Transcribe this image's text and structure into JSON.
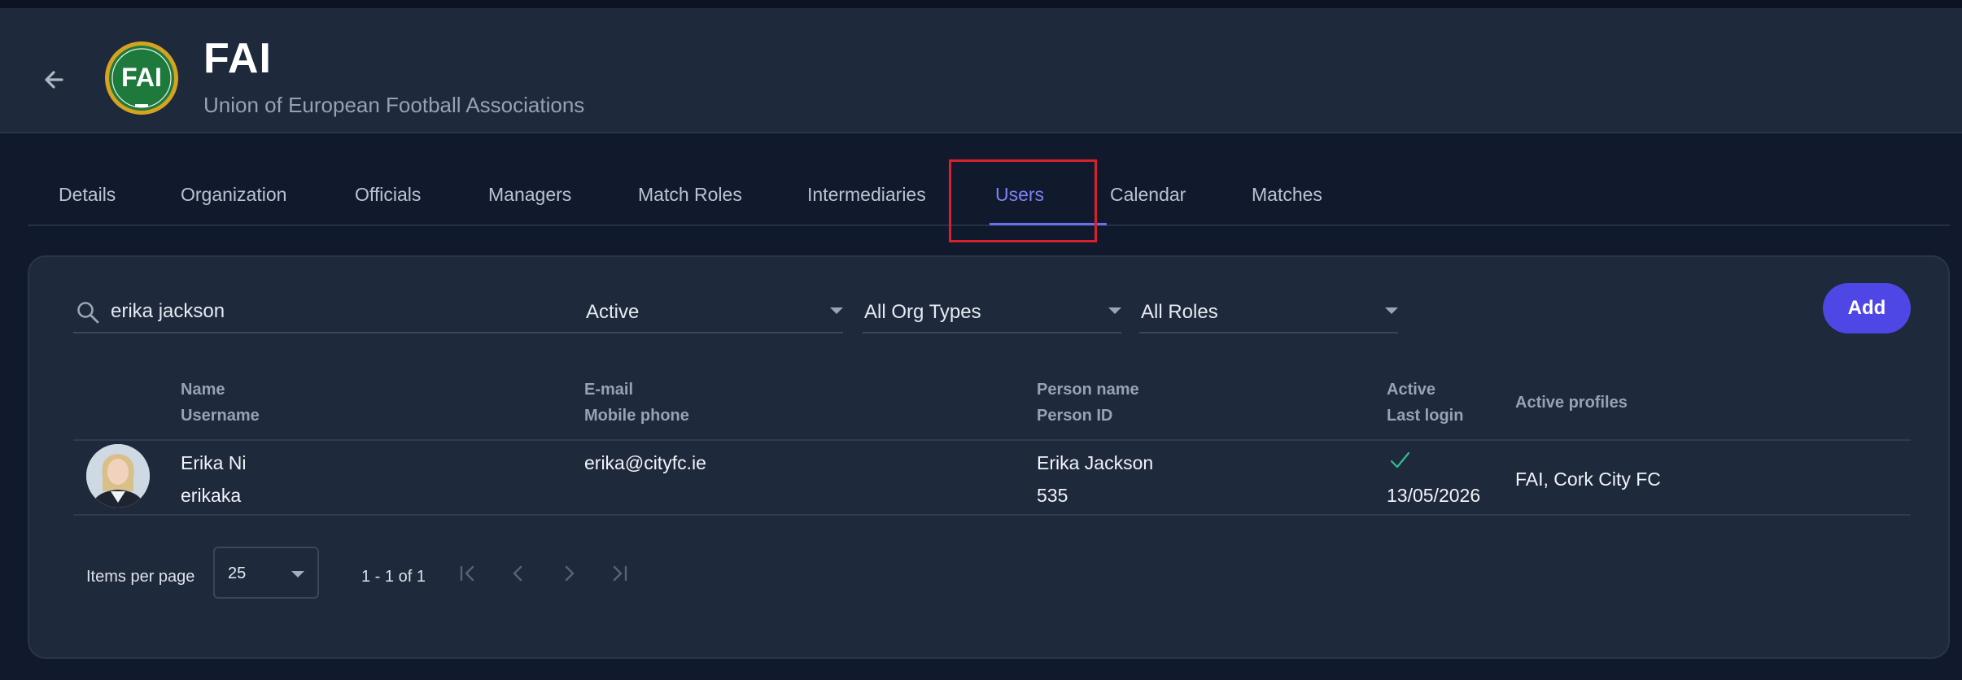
{
  "org": {
    "title": "FAI",
    "subtitle": "Union of European Football Associations",
    "logo_text": "FAI",
    "back_icon": "arrow-left-icon"
  },
  "tabs": [
    {
      "label": "Details",
      "active": false
    },
    {
      "label": "Organization",
      "active": false
    },
    {
      "label": "Officials",
      "active": false
    },
    {
      "label": "Managers",
      "active": false
    },
    {
      "label": "Match Roles",
      "active": false
    },
    {
      "label": "Intermediaries",
      "active": false
    },
    {
      "label": "Users",
      "active": true
    },
    {
      "label": "Calendar",
      "active": false
    },
    {
      "label": "Matches",
      "active": false
    }
  ],
  "filters": {
    "search_value": "erika jackson",
    "status": "Active",
    "org_type": "All Org Types",
    "roles": "All Roles"
  },
  "add_label": "Add",
  "table": {
    "headers": {
      "name": "Name",
      "username": "Username",
      "email": "E-mail",
      "mobile": "Mobile phone",
      "person_name": "Person name",
      "person_id": "Person ID",
      "active": "Active",
      "last_login": "Last login",
      "active_profiles": "Active profiles"
    },
    "rows": [
      {
        "name": "Erika Ni",
        "username": "erikaka",
        "email": "erika@cityfc.ie",
        "mobile": "",
        "person_name": "Erika Jackson",
        "person_id": "535",
        "active": true,
        "last_login": "13/05/2026",
        "active_profiles": "FAI, Cork City FC"
      }
    ]
  },
  "pagination": {
    "items_per_page_label": "Items per page",
    "items_per_page": "25",
    "range": "1 - 1 of 1"
  },
  "colors": {
    "accent": "#4e46e5",
    "tab_active": "#7c82f5",
    "highlight": "#d8202e",
    "check": "#2fbf8f",
    "logo_green": "#1e7a3c",
    "logo_gold": "#d6a31f"
  }
}
